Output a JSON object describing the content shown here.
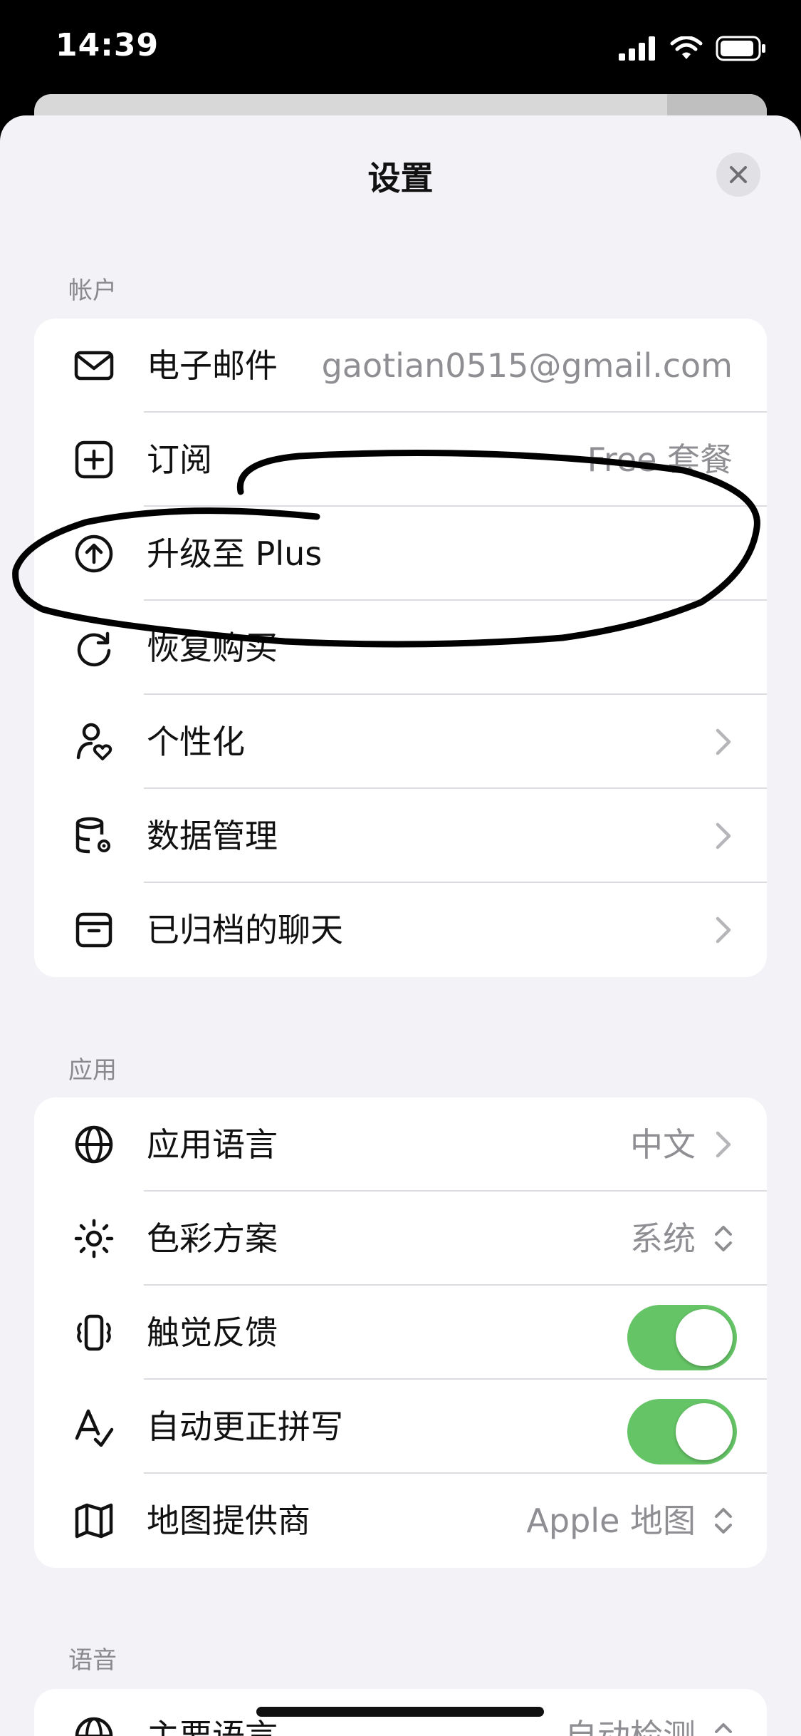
{
  "status_bar": {
    "time": "14:39"
  },
  "sheet": {
    "title": "设置"
  },
  "account": {
    "section_label": "帐户",
    "rows": [
      {
        "label": "电子邮件",
        "value": "gaotian0515@gmail.com"
      },
      {
        "label": "订阅",
        "value": "Free 套餐"
      },
      {
        "label": "升级至 Plus"
      },
      {
        "label": "恢复购买"
      },
      {
        "label": "个性化"
      },
      {
        "label": "数据管理"
      },
      {
        "label": "已归档的聊天"
      }
    ]
  },
  "app": {
    "section_label": "应用",
    "rows": [
      {
        "label": "应用语言",
        "value": "中文"
      },
      {
        "label": "色彩方案",
        "value": "系统"
      },
      {
        "label": "触觉反馈",
        "toggle": true
      },
      {
        "label": "自动更正拼写",
        "toggle": true
      },
      {
        "label": "地图提供商",
        "value": "Apple 地图"
      }
    ]
  },
  "voice": {
    "section_label": "语音",
    "rows": [
      {
        "label": "主要语言",
        "value": "自动检测"
      }
    ]
  },
  "colors": {
    "toggle_on": "#65c466",
    "annotation_ink": "#000000"
  }
}
